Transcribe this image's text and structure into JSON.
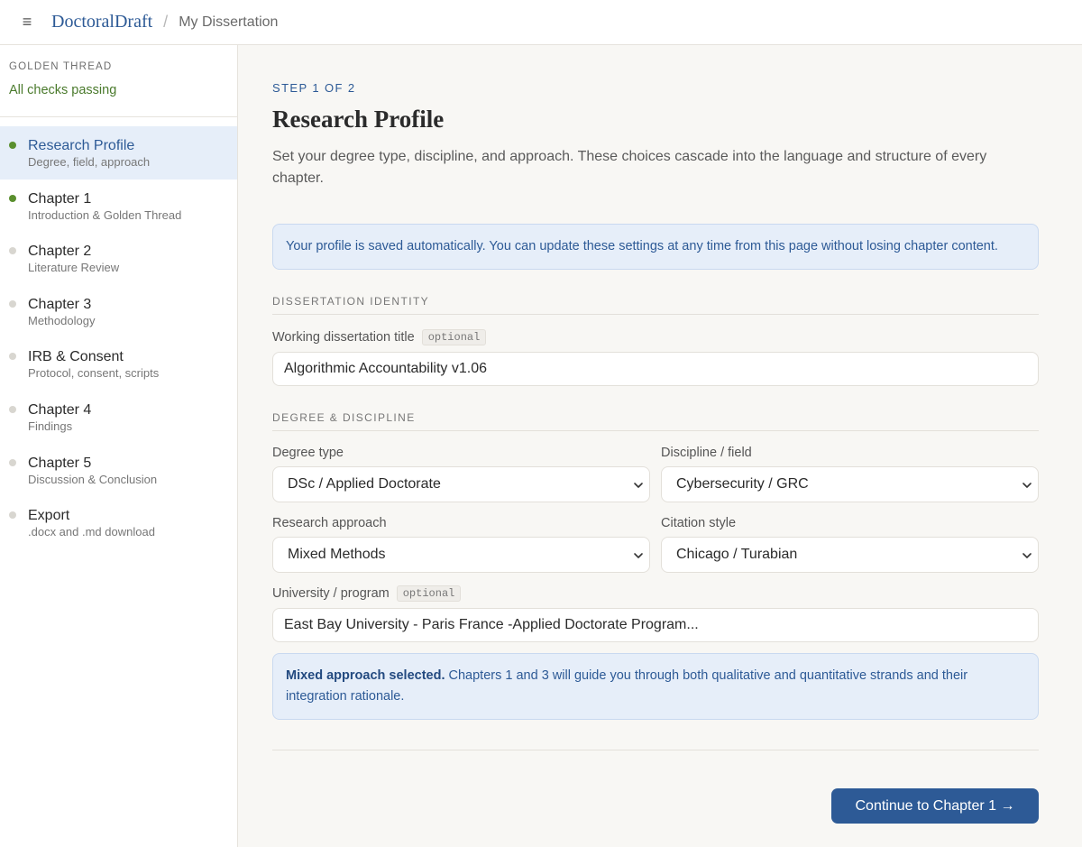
{
  "header": {
    "brand": "DoctoralDraft",
    "separator": "/",
    "breadcrumb": "My Dissertation",
    "menu_icon": "≡"
  },
  "sidebar": {
    "golden_thread_label": "GOLDEN THREAD",
    "golden_thread_status": "All checks passing",
    "items": [
      {
        "title": "Research Profile",
        "subtitle": "Degree, field, approach",
        "status": "done",
        "active": true
      },
      {
        "title": "Chapter 1",
        "subtitle": "Introduction & Golden Thread",
        "status": "done",
        "active": false
      },
      {
        "title": "Chapter 2",
        "subtitle": "Literature Review",
        "status": "pending",
        "active": false
      },
      {
        "title": "Chapter 3",
        "subtitle": "Methodology",
        "status": "pending",
        "active": false
      },
      {
        "title": "IRB & Consent",
        "subtitle": "Protocol, consent, scripts",
        "status": "pending",
        "active": false
      },
      {
        "title": "Chapter 4",
        "subtitle": "Findings",
        "status": "pending",
        "active": false
      },
      {
        "title": "Chapter 5",
        "subtitle": "Discussion & Conclusion",
        "status": "pending",
        "active": false
      },
      {
        "title": "Export",
        "subtitle": ".docx and .md download",
        "status": "pending",
        "active": false
      }
    ]
  },
  "main": {
    "step": "STEP 1 OF 2",
    "title": "Research Profile",
    "lede": "Set your degree type, discipline, and approach. These choices cascade into the language and structure of every chapter.",
    "info": "Your profile is saved automatically. You can update these settings at any time from this page without losing chapter content.",
    "identity_heading": "DISSERTATION IDENTITY",
    "title_label": "Working dissertation title",
    "optional_tag": "optional",
    "title_value": "Algorithmic Accountability v1.06",
    "degree_heading": "DEGREE & DISCIPLINE",
    "degree_label": "Degree type",
    "degree_value": "DSc / Applied Doctorate",
    "discipline_label": "Discipline / field",
    "discipline_value": "Cybersecurity / GRC",
    "approach_label": "Research approach",
    "approach_value": "Mixed Methods",
    "citation_label": "Citation style",
    "citation_value": "Chicago / Turabian",
    "university_label": "University / program",
    "university_value": "East Bay University - Paris France -Applied Doctorate Program...",
    "note_bold": "Mixed approach selected.",
    "note_text": " Chapters 1 and 3 will guide you through both qualitative and quantitative strands and their integration rationale.",
    "cta": "Continue to Chapter 1 →"
  },
  "colors": {
    "accent": "#2d5a96",
    "success": "#5a8f2e",
    "pending_dot": "#d8d6d0",
    "info_bg": "#e6eef9"
  }
}
